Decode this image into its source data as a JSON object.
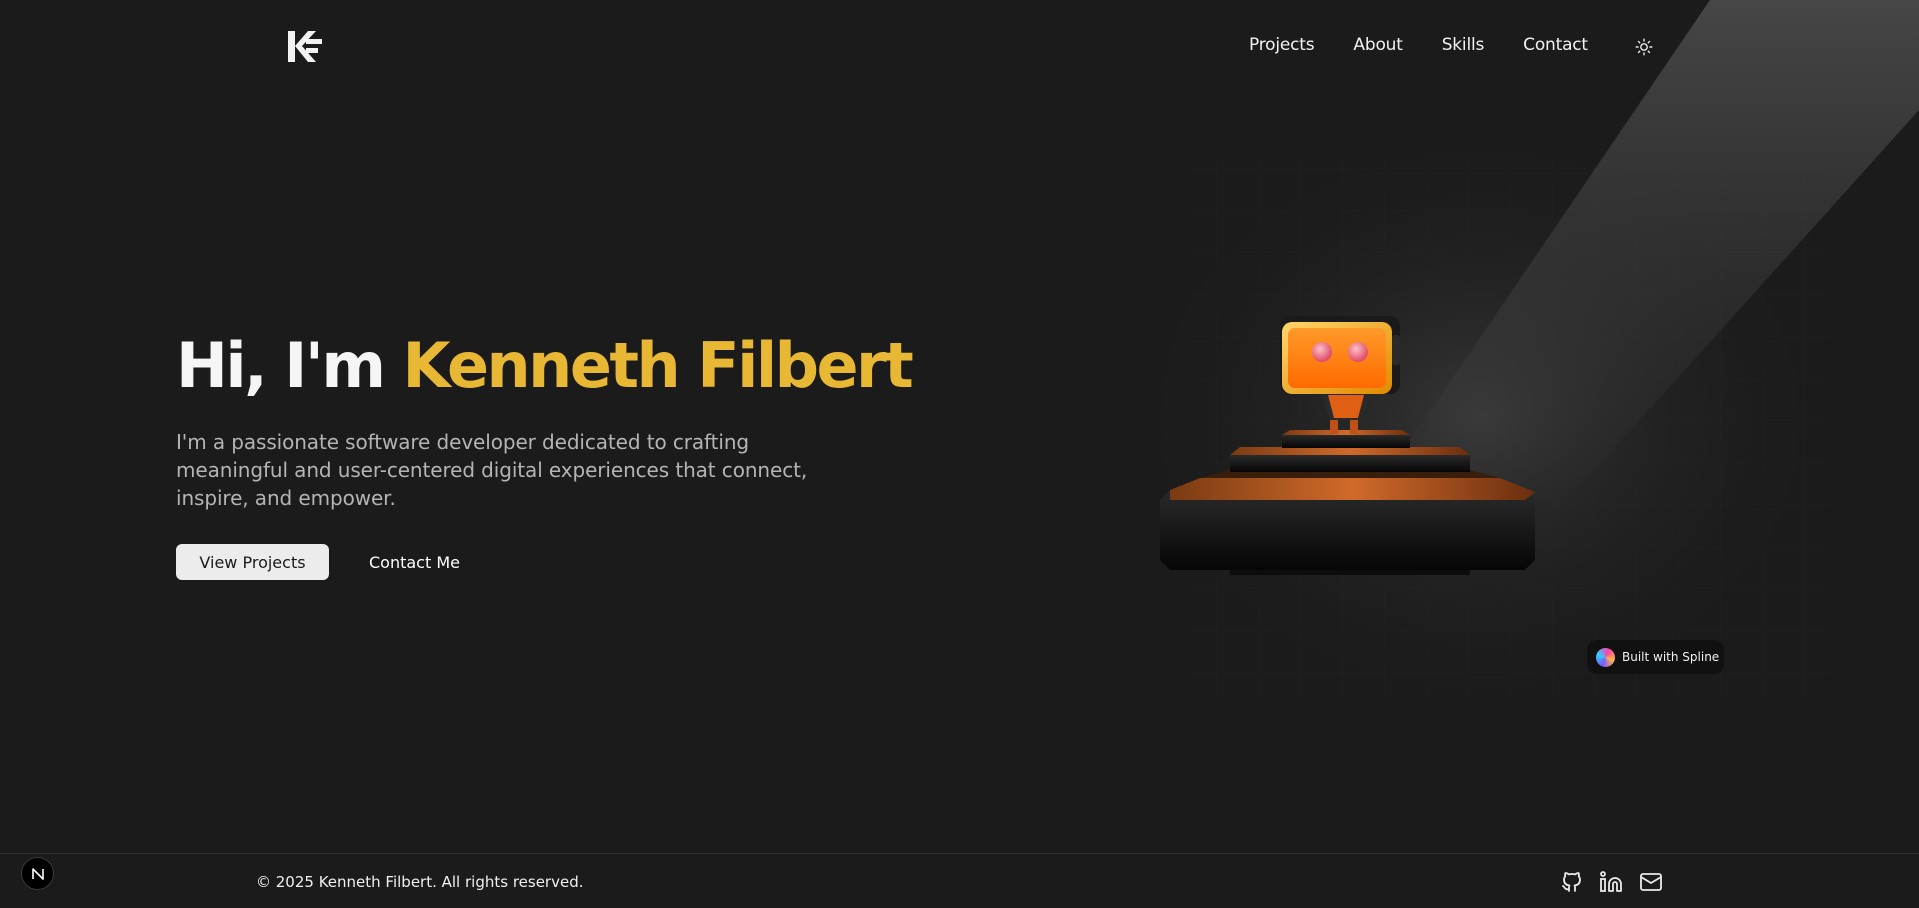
{
  "header": {
    "logo_text": "KF",
    "nav": [
      "Projects",
      "About",
      "Skills",
      "Contact"
    ],
    "theme_toggle_icon": "sun-icon"
  },
  "hero": {
    "greeting": "Hi, I'm",
    "name": "Kenneth Filbert",
    "description": "I'm a passionate software developer dedicated to crafting meaningful and user-centered digital experiences that connect, inspire, and empower.",
    "primary_button": "View Projects",
    "secondary_button": "Contact Me"
  },
  "spline_badge": {
    "label": "Built with Spline"
  },
  "footer": {
    "copyright": "© 2025 Kenneth Filbert. All rights reserved.",
    "social": [
      "github-icon",
      "linkedin-icon",
      "mail-icon"
    ]
  },
  "next_badge": {
    "label": "N"
  },
  "colors": {
    "background": "#1b1b1b",
    "accent": "#e8b834",
    "robot_orange": "#ff7a12",
    "button_bg": "#ececec"
  }
}
